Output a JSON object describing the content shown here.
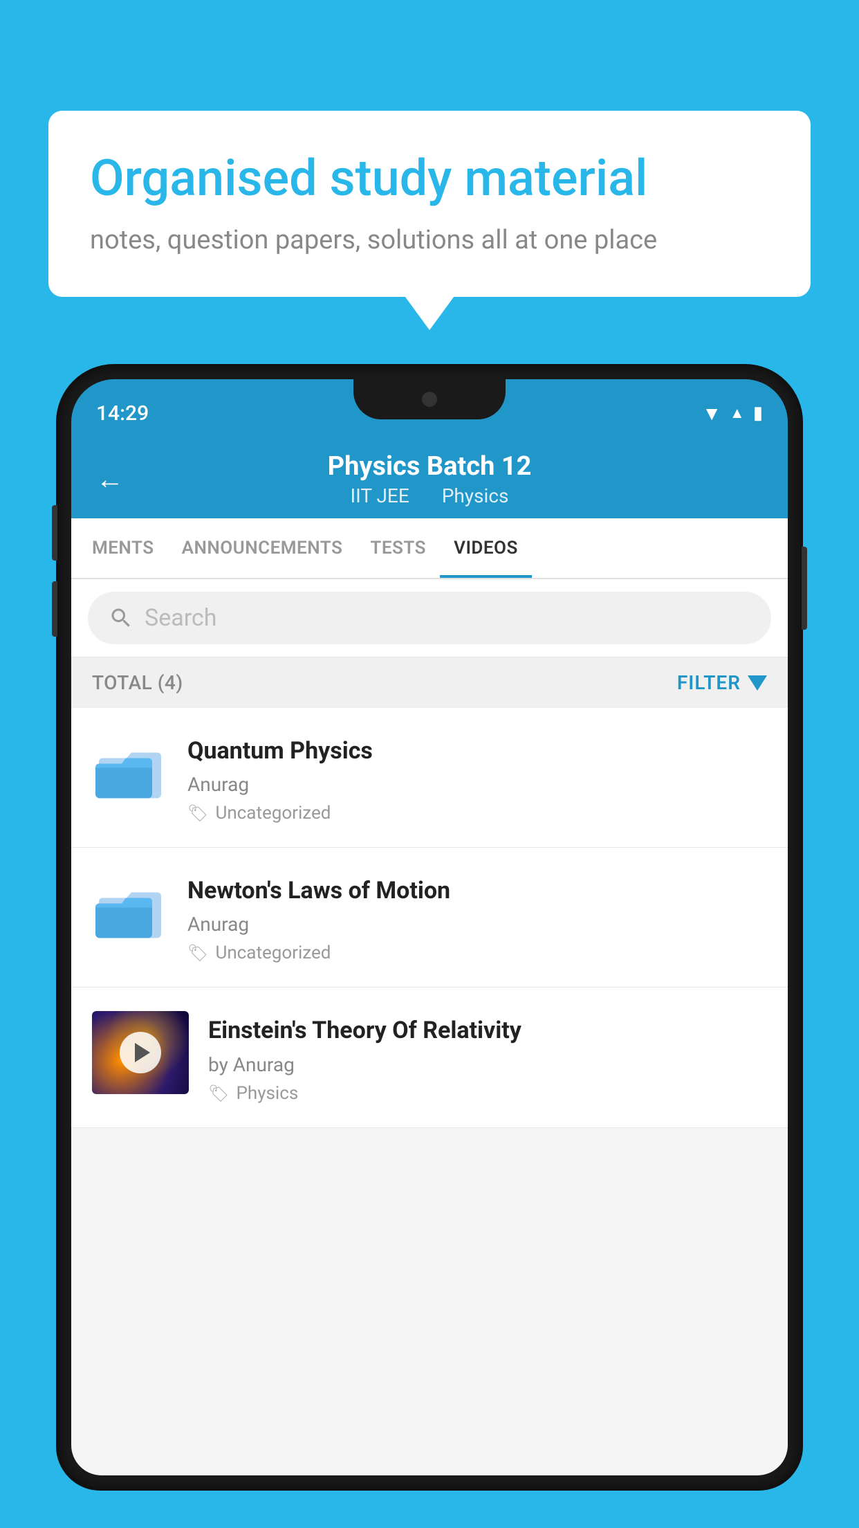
{
  "background_color": "#29b6e8",
  "bubble": {
    "title": "Organised study material",
    "subtitle": "notes, question papers, solutions all at one place"
  },
  "phone": {
    "status_bar": {
      "time": "14:29"
    },
    "header": {
      "back_label": "←",
      "title": "Physics Batch 12",
      "subtitle_parts": [
        "IIT JEE",
        "Physics"
      ]
    },
    "tabs": [
      {
        "label": "MENTS",
        "active": false
      },
      {
        "label": "ANNOUNCEMENTS",
        "active": false
      },
      {
        "label": "TESTS",
        "active": false
      },
      {
        "label": "VIDEOS",
        "active": true
      }
    ],
    "search": {
      "placeholder": "Search"
    },
    "filter_row": {
      "total_label": "TOTAL (4)",
      "filter_label": "FILTER"
    },
    "videos": [
      {
        "id": 1,
        "title": "Quantum Physics",
        "author": "Anurag",
        "tag": "Uncategorized",
        "has_thumbnail": false
      },
      {
        "id": 2,
        "title": "Newton's Laws of Motion",
        "author": "Anurag",
        "tag": "Uncategorized",
        "has_thumbnail": false
      },
      {
        "id": 3,
        "title": "Einstein's Theory Of Relativity",
        "author": "by Anurag",
        "tag": "Physics",
        "has_thumbnail": true
      }
    ]
  }
}
